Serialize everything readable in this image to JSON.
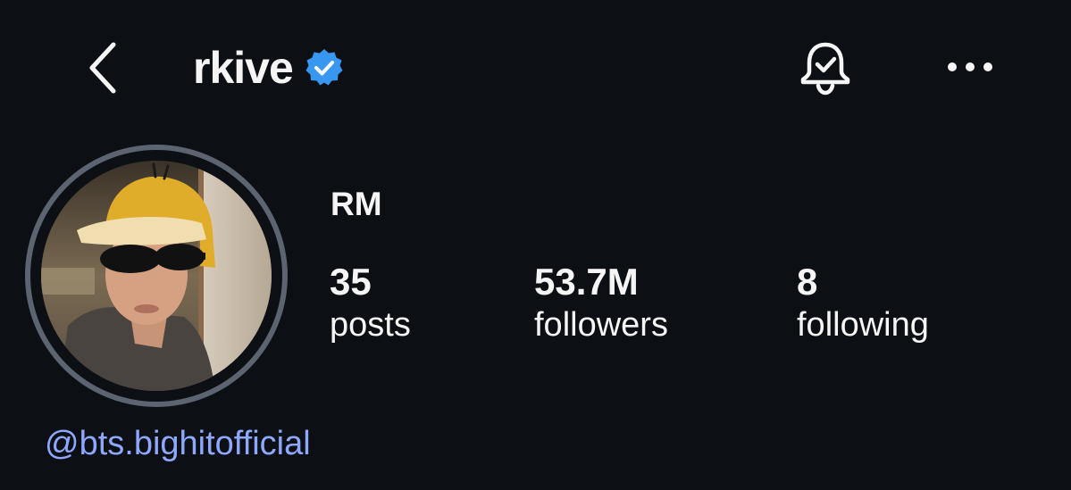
{
  "header": {
    "username": "rkive",
    "back_icon": "chevron-left-icon",
    "verified_icon": "verified-badge-icon",
    "notification_icon": "bell-check-icon",
    "more_icon": "more-horizontal-icon"
  },
  "profile": {
    "display_name": "RM",
    "avatar": "profile-photo",
    "link": "@bts.bighitofficial"
  },
  "stats": {
    "posts": {
      "value": "35",
      "label": "posts"
    },
    "followers": {
      "value": "53.7M",
      "label": "followers"
    },
    "following": {
      "value": "8",
      "label": "following"
    }
  },
  "colors": {
    "background": "#0c1014",
    "text": "#f5f5f5",
    "verified_blue": "#3897f0",
    "link": "#8fa8ff",
    "avatar_ring": "#5b6470"
  }
}
